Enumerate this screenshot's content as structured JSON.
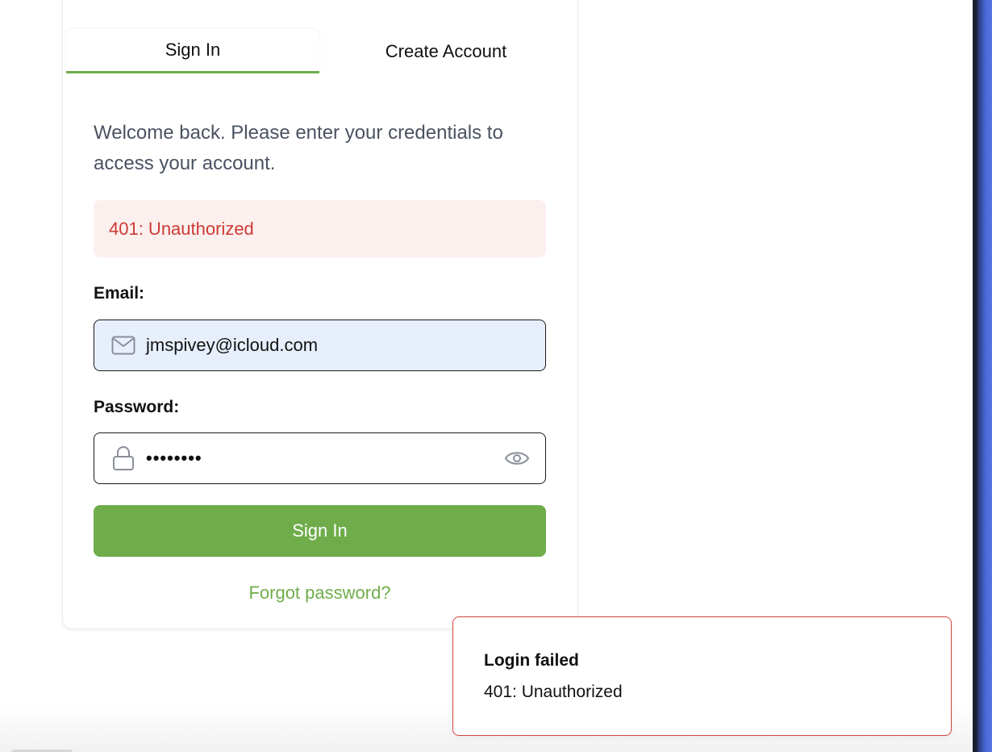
{
  "tabs": [
    {
      "label": "Sign In",
      "active": true
    },
    {
      "label": "Create Account",
      "active": false
    }
  ],
  "intro": "Welcome back. Please enter your credentials to access your account.",
  "error_banner": "401: Unauthorized",
  "email": {
    "label": "Email:",
    "value": "jmspivey@icloud.com",
    "icon": "mail-icon"
  },
  "password": {
    "label": "Password:",
    "masked_value": "••••••••",
    "icon": "lock-icon",
    "toggle_icon": "eye-icon"
  },
  "sign_in_button": "Sign In",
  "forgot_link": "Forgot password?",
  "toast": {
    "title": "Login failed",
    "message": "401: Unauthorized"
  },
  "colors": {
    "accent": "#6fad4a",
    "error_text": "#cc3a33",
    "error_bg": "#fcf0ef",
    "email_bg": "#e8effc",
    "toast_border": "#d1453f"
  }
}
